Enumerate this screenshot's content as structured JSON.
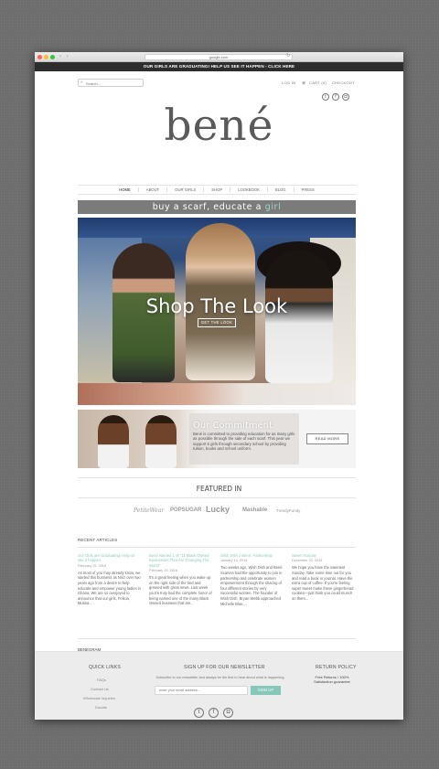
{
  "browser": {
    "url": "google.com"
  },
  "promo_bar": "OUR GIRLS ARE GRADUATING! HELP US SEE IT HAPPEN - CLICK HERE",
  "header": {
    "search_placeholder": "Search...",
    "login": "LOG IN",
    "cart": "CART (0)",
    "checkout": "CHECKOUT",
    "social": [
      "twitter",
      "facebook",
      "instagram"
    ]
  },
  "logo": "bené",
  "nav": [
    "HOME",
    "ABOUT",
    "OUR GIRLS",
    "SHOP",
    "LOOKBOOK",
    "BLOG",
    "PRESS"
  ],
  "tagline": {
    "main": "buy a scarf, educate a",
    "accent": "girl"
  },
  "hero": {
    "title": "Shop The Look",
    "button": "GET THE LOOK"
  },
  "commitment": {
    "title": "Our Commitment",
    "text": "Bené is committed to providing education for as many girls as possible through the sale of each scarf. This year we support 5 girls through secondary school by providing tuition, books and school uniform.",
    "button": "READ MORE"
  },
  "featured": {
    "title": "FEATURED IN",
    "press": [
      "PetiteWear",
      "POPSUGAR",
      "Lucky",
      "Mashable",
      "TrendyFundy"
    ]
  },
  "recent_articles": {
    "title": "RECENT ARTICLES",
    "items": [
      {
        "title": "Our Girls are Graduating! Help us see it happen",
        "date": "February 25, 2016",
        "excerpt": "As most of you may already know, we started this business as Ninz over two years ago from a desire to help educate and empower young ladies in Ghana. We are so overjoyed to announce that our girls, Felicia, Mutina..."
      },
      {
        "title": "Bené Named 1 of \"11 Black Owned Businesses That Are Changing The World\"",
        "date": "February 10, 2016",
        "excerpt": "It's a great feeling when you wake up on the right side of the bed and greeted with great news. Last week you're truly had the complete honor of being named one of the many Black Owned business that are..."
      },
      {
        "title": "Wish Dish x Bené: Partnership",
        "date": "January 14, 2016",
        "excerpt": "Two weeks ago, Wish Dish and Bené Scarves had the opportunity to join in partnership and celebrate women empowerment through the sharing of four different stories by very successful women. The founder of Wish Dish, Bryan Webb approached Michelle Blue,..."
      },
      {
        "title": "Sweet Sunday",
        "date": "December 20, 2015",
        "excerpt": "We hope you have the sweetest Sunday. Take some time out for you and read a book or journal. Have the extra cup of coffee. If you're feeling super sweet make these gingerbread cookies—just think you could munch on them..."
      }
    ]
  },
  "benegram": "BENEGRAM",
  "footer": {
    "quick_links": {
      "title": "QUICK LINKS",
      "items": [
        "FAQs",
        "Contact Us",
        "Wholesale Inquiries",
        "Donate"
      ]
    },
    "newsletter": {
      "title": "SIGN UP FOR OUR NEWSLETTER",
      "subtitle": "Subscribe to our newsletter and always be the first to hear about what is happening.",
      "placeholder": "enter your email address...",
      "button": "SIGN UP"
    },
    "policy": {
      "title": "RETURN POLICY",
      "text": "Free Returns / 100% Satisfaction guarantee"
    },
    "social": [
      "twitter",
      "facebook",
      "instagram"
    ]
  },
  "colors": {
    "accent": "#86c8b8",
    "promo_bg": "#2d2d2d",
    "tagline_bg": "#7b7b7b"
  }
}
